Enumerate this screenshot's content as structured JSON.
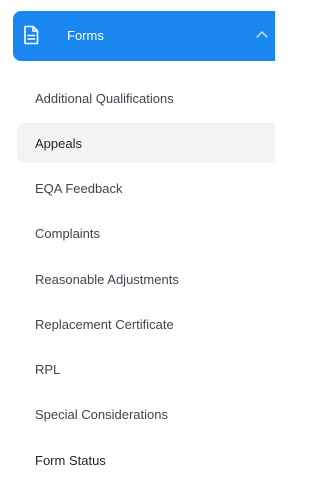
{
  "sidebar": {
    "header": {
      "label": "Forms",
      "icon": "document-icon",
      "expanded_icon": "chevron-up-icon",
      "color": "#1a87f0"
    },
    "items": [
      {
        "label": "Additional Qualifications"
      },
      {
        "label": "Appeals",
        "active": true
      },
      {
        "label": "EQA Feedback"
      },
      {
        "label": "Complaints"
      },
      {
        "label": "Reasonable Adjustments"
      },
      {
        "label": "Replacement Certificate"
      },
      {
        "label": "RPL"
      },
      {
        "label": "Special Considerations"
      },
      {
        "label": "Form Status"
      }
    ]
  }
}
